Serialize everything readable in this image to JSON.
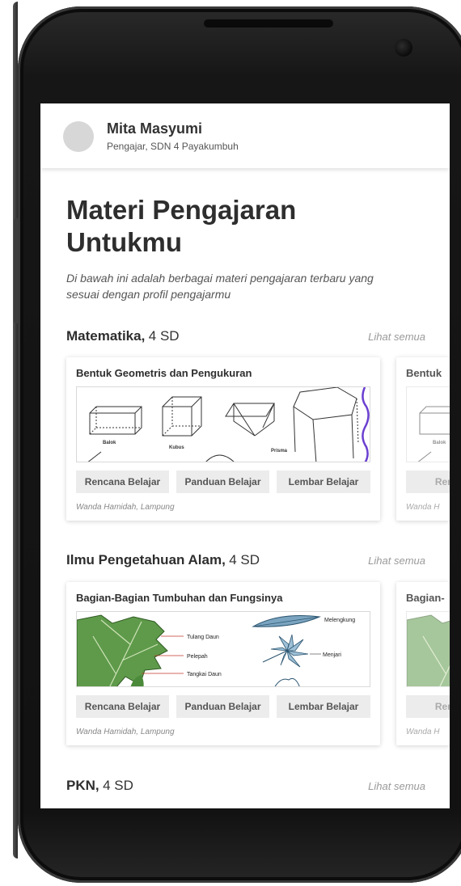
{
  "user": {
    "name": "Mita Masyumi",
    "role": "Pengajar, SDN 4 Payakumbuh"
  },
  "page": {
    "title": "Materi Pengajaran Untukmu",
    "subtitle": "Di bawah ini adalah berbagai materi pengajaran terbaru yang sesuai dengan profil pengajarmu"
  },
  "sections": [
    {
      "name": "Matematika,",
      "grade": "4 SD",
      "see_all": "Lihat semua",
      "card": {
        "title": "Bentuk Geometris dan Pengukuran",
        "image_labels": [
          "Balok",
          "Kubus",
          "Prisma"
        ],
        "buttons": [
          "Rencana Belajar",
          "Panduan Belajar",
          "Lembar Belajar"
        ],
        "author": "Wanda Hamidah, Lampung"
      },
      "peek_card": {
        "title": "Bentuk",
        "image_label": "Balok",
        "button": "Rencan",
        "author": "Wanda H"
      }
    },
    {
      "name": "Ilmu Pengetahuan Alam,",
      "grade": "4 SD",
      "see_all": "Lihat semua",
      "card": {
        "title": "Bagian-Bagian Tumbuhan dan Fungsinya",
        "image_labels": [
          "Tulang Daun",
          "Pelepah",
          "Tangkai Daun",
          "Melengkung",
          "Menjari"
        ],
        "buttons": [
          "Rencana Belajar",
          "Panduan Belajar",
          "Lembar Belajar"
        ],
        "author": "Wanda Hamidah, Lampung"
      },
      "peek_card": {
        "title": "Bagian-",
        "button": "Rencan",
        "author": "Wanda H"
      }
    },
    {
      "name": "PKN,",
      "grade": "4 SD",
      "see_all": "Lihat semua"
    }
  ],
  "colors": {
    "phone_body": "#161616",
    "screen_bg": "#ffffff",
    "button_bg": "#ececec",
    "leaf_green": "#5e9a4a",
    "accent_purple": "#6a3fd0"
  }
}
